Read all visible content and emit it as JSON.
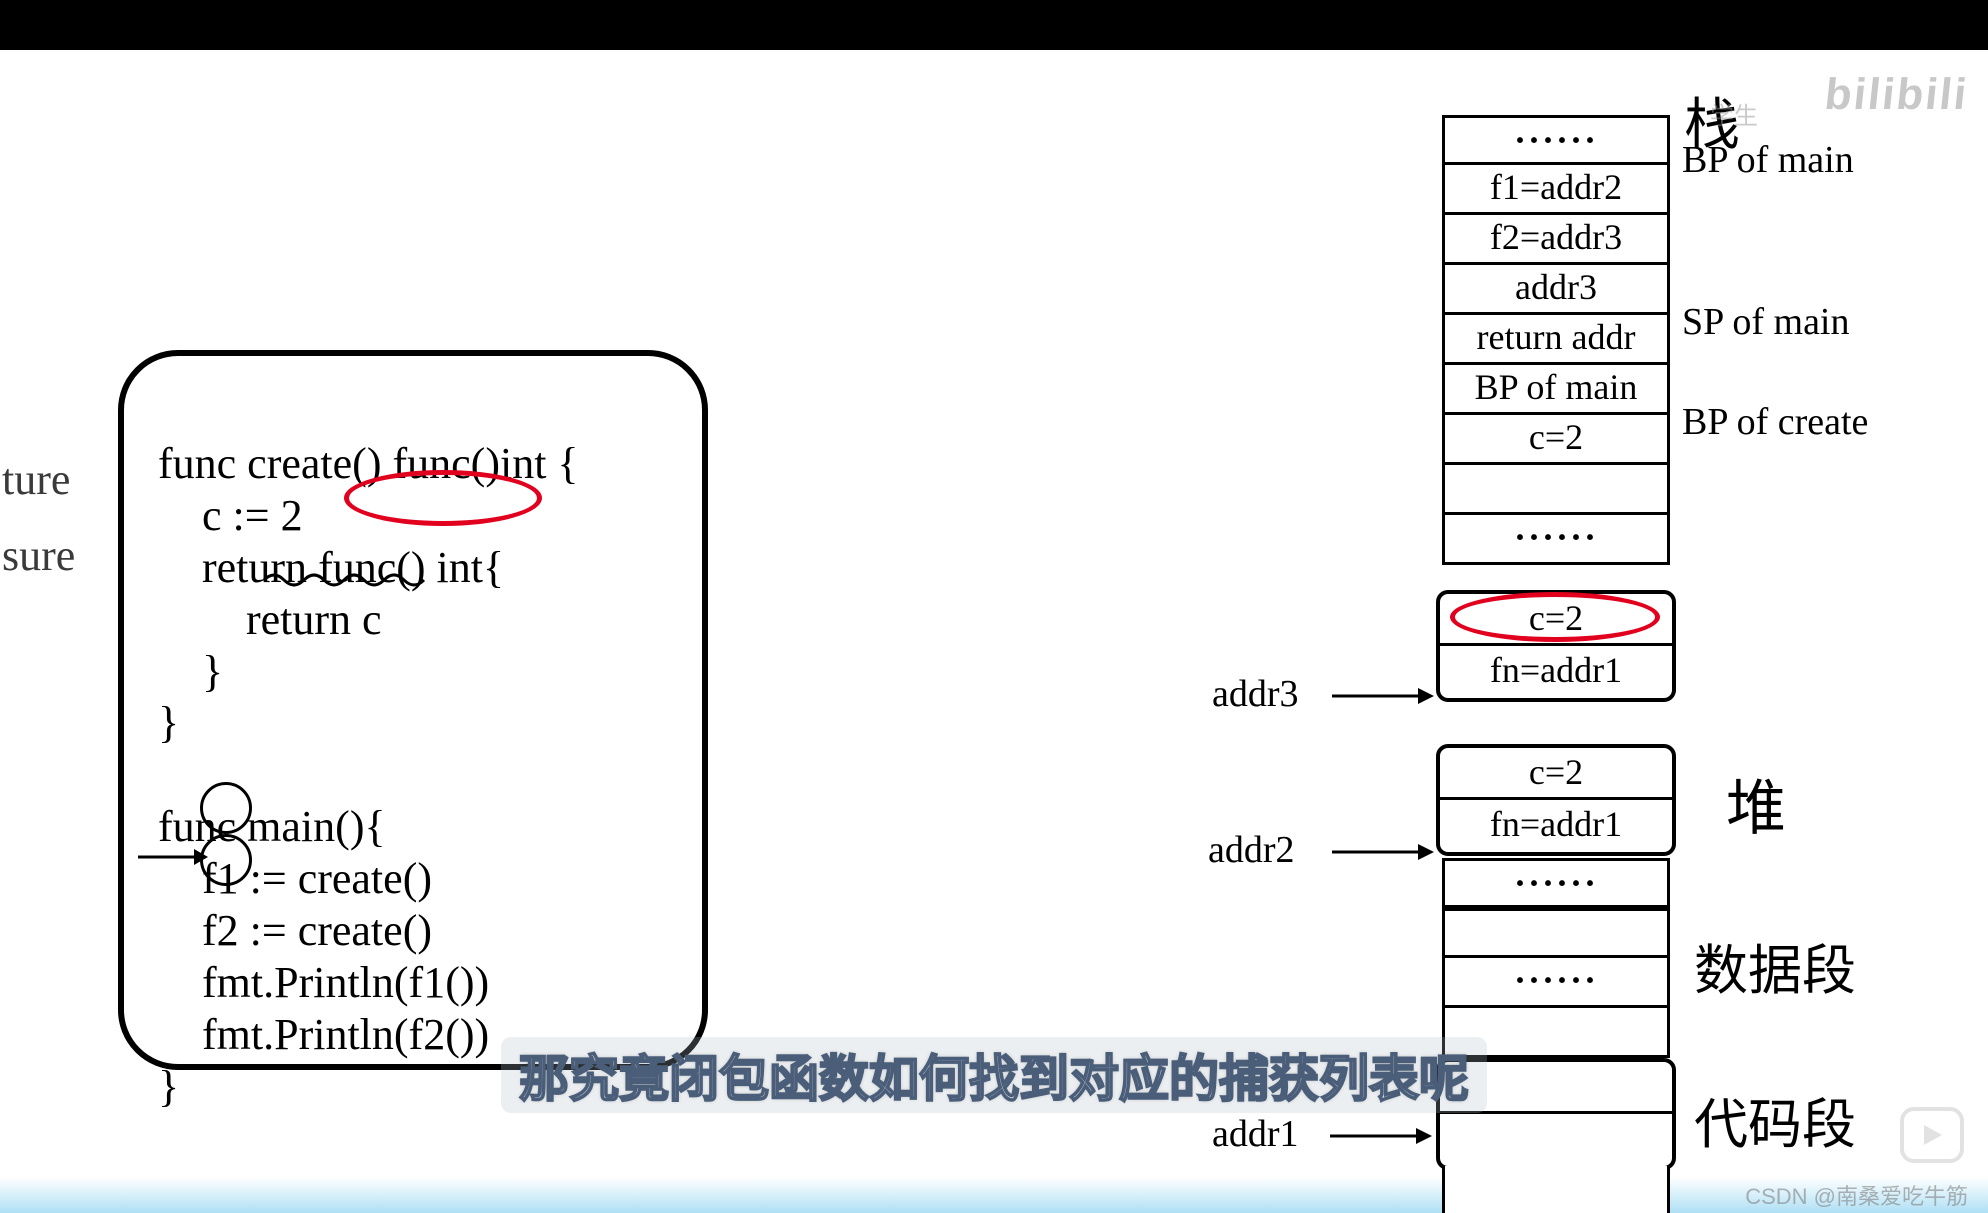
{
  "code": {
    "line1": "func create() func()int {",
    "line2": "    c := 2",
    "line3_pre": "    return ",
    "line3_oval": "func() int",
    "line3_post": "{",
    "line4": "        return c",
    "line5": "    }",
    "line6": "}",
    "line7": "",
    "line8": "func main(){",
    "line9_pre": "    ",
    "line9_f": "f1",
    "line9_post": " := create()",
    "line10_pre": "    ",
    "line10_f": "f2",
    "line10_post": " := create()",
    "line11": "    fmt.Println(f1())",
    "line12": "    fmt.Println(f2())",
    "line13": "}"
  },
  "cut_left": {
    "a": "ture",
    "b": "sure"
  },
  "stack_cells": [
    "······",
    "f1=addr2",
    "f2=addr3",
    "addr3",
    "return addr",
    "BP of main",
    "c=2",
    "",
    "······"
  ],
  "heap_group1": {
    "c": "c=2",
    "fn": "fn=addr1"
  },
  "heap_group2": {
    "c": "c=2",
    "fn": "fn=addr1"
  },
  "mid_dots1": "······",
  "data_seg_dots": "······",
  "side": {
    "zhan": "栈",
    "bp_main": "BP of main",
    "sp_main": "SP of main",
    "bp_create": "BP of create",
    "heap": "堆",
    "data_seg": "数据段",
    "code_seg": "代码段"
  },
  "addr": {
    "addr3": "addr3",
    "addr2": "addr2",
    "addr1": "addr1"
  },
  "subtitle": "那究竟闭包函数如何找到对应的捕获列表呢",
  "csdn": "CSDN @南桑爱吃牛筋",
  "bili_logo": "bilibili",
  "bili_sub": "学生"
}
